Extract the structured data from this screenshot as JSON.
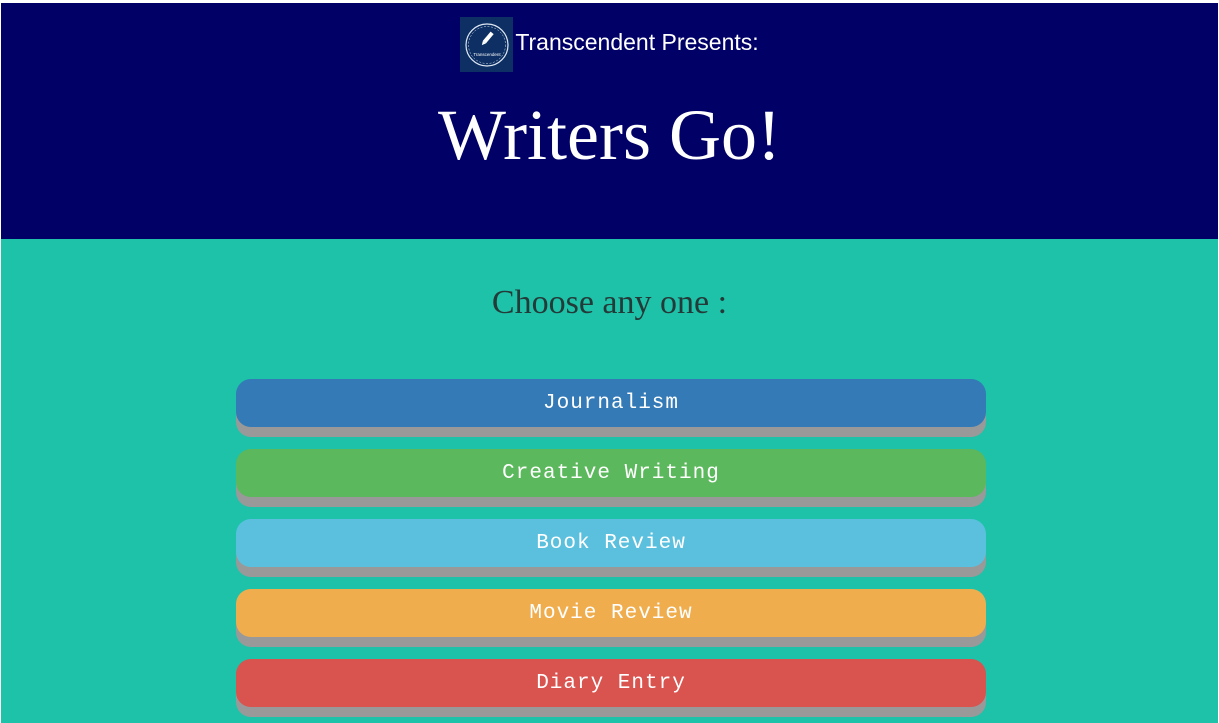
{
  "header": {
    "brand_text": "Transcendent Presents:",
    "logo_text": "Transcendent",
    "title": "Writers Go!"
  },
  "main": {
    "prompt": "Choose any one :",
    "choices": [
      {
        "label": "Journalism",
        "color": "#337ab7"
      },
      {
        "label": "Creative Writing",
        "color": "#5cb85c"
      },
      {
        "label": "Book Review",
        "color": "#5bc0de"
      },
      {
        "label": "Movie Review",
        "color": "#f0ad4e"
      },
      {
        "label": "Diary Entry",
        "color": "#d9534f"
      }
    ]
  },
  "colors": {
    "header_bg": "#000066",
    "main_bg": "#1dc2a9",
    "button_shadow": "#999999"
  }
}
